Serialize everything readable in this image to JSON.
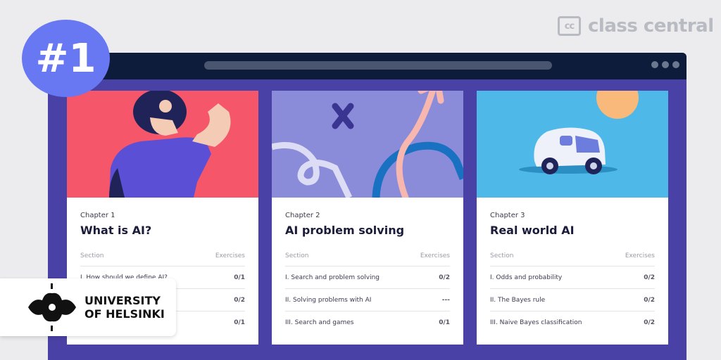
{
  "brand": {
    "logo_mark": "cc",
    "name": "class central"
  },
  "ranking_badge": "#1",
  "university": {
    "line1": "UNIVERSITY",
    "line2": "OF HELSINKI"
  },
  "cards": [
    {
      "chapter": "Chapter 1",
      "title": "What is AI?",
      "section_header": "Section",
      "exercises_header": "Exercises",
      "rows": [
        {
          "section": "I. How should we define AI?",
          "score": "0/1"
        },
        {
          "section": "",
          "score": "0/2"
        },
        {
          "section": "",
          "score": "0/1"
        }
      ]
    },
    {
      "chapter": "Chapter 2",
      "title": "AI problem solving",
      "section_header": "Section",
      "exercises_header": "Exercises",
      "rows": [
        {
          "section": "I. Search and problem solving",
          "score": "0/2"
        },
        {
          "section": "II. Solving problems with AI",
          "score": "---"
        },
        {
          "section": "III. Search and games",
          "score": "0/1"
        }
      ]
    },
    {
      "chapter": "Chapter 3",
      "title": "Real world AI",
      "section_header": "Section",
      "exercises_header": "Exercises",
      "rows": [
        {
          "section": "I. Odds and probability",
          "score": "0/2"
        },
        {
          "section": "II. The Bayes rule",
          "score": "0/2"
        },
        {
          "section": "III. Naive Bayes classification",
          "score": "0/2"
        }
      ]
    }
  ],
  "colors": {
    "badge": "#6877f2",
    "browser_frame": "#4a41a6",
    "chapter1_illustration": "#f5566a",
    "chapter2_illustration": "#8a8bd9",
    "chapter3_illustration": "#4eb8e8"
  }
}
